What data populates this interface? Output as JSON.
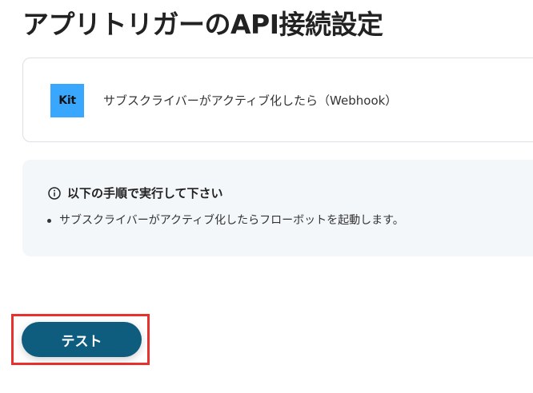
{
  "page_title": "アプリトリガーのAPI接続設定",
  "app_card": {
    "logo_text": "Kit",
    "logo_color": "#3aa7ff",
    "trigger_label": "サブスクライバーがアクティブ化したら（Webhook）"
  },
  "info_box": {
    "icon": "info-circle-icon",
    "heading": "以下の手順で実行して下さい",
    "steps": [
      "サブスクライバーがアクティブ化したらフローボットを起動します。"
    ]
  },
  "test_button": {
    "label": "テスト",
    "color": "#0f5d7e"
  },
  "highlight_color": "#e8312c"
}
